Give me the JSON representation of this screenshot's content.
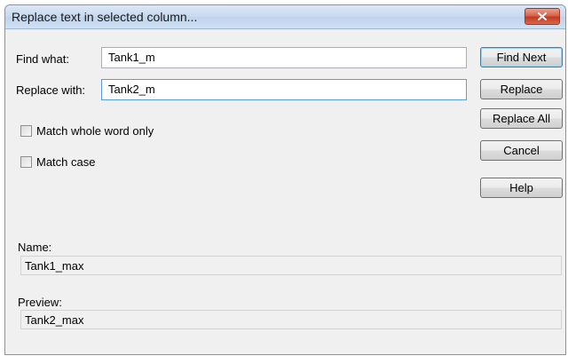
{
  "dialog": {
    "title": "Replace text in selected column...",
    "close_icon": "close-icon"
  },
  "find": {
    "label": "Find what:",
    "value": "Tank1_m"
  },
  "replace": {
    "label": "Replace with:",
    "value": "Tank2_m"
  },
  "options": {
    "match_whole_word": {
      "label": "Match whole word only",
      "checked": false
    },
    "match_case": {
      "label": "Match case",
      "checked": false
    }
  },
  "buttons": {
    "find_next": "Find Next",
    "replace": "Replace",
    "replace_all": "Replace All",
    "cancel": "Cancel",
    "help": "Help"
  },
  "name": {
    "label": "Name:",
    "value": "Tank1_max"
  },
  "preview": {
    "label": "Preview:",
    "value": "Tank2_max"
  },
  "colors": {
    "close_button": "#c5391e",
    "focus_border": "#569de5",
    "dialog_bg": "#f0f0f0"
  }
}
